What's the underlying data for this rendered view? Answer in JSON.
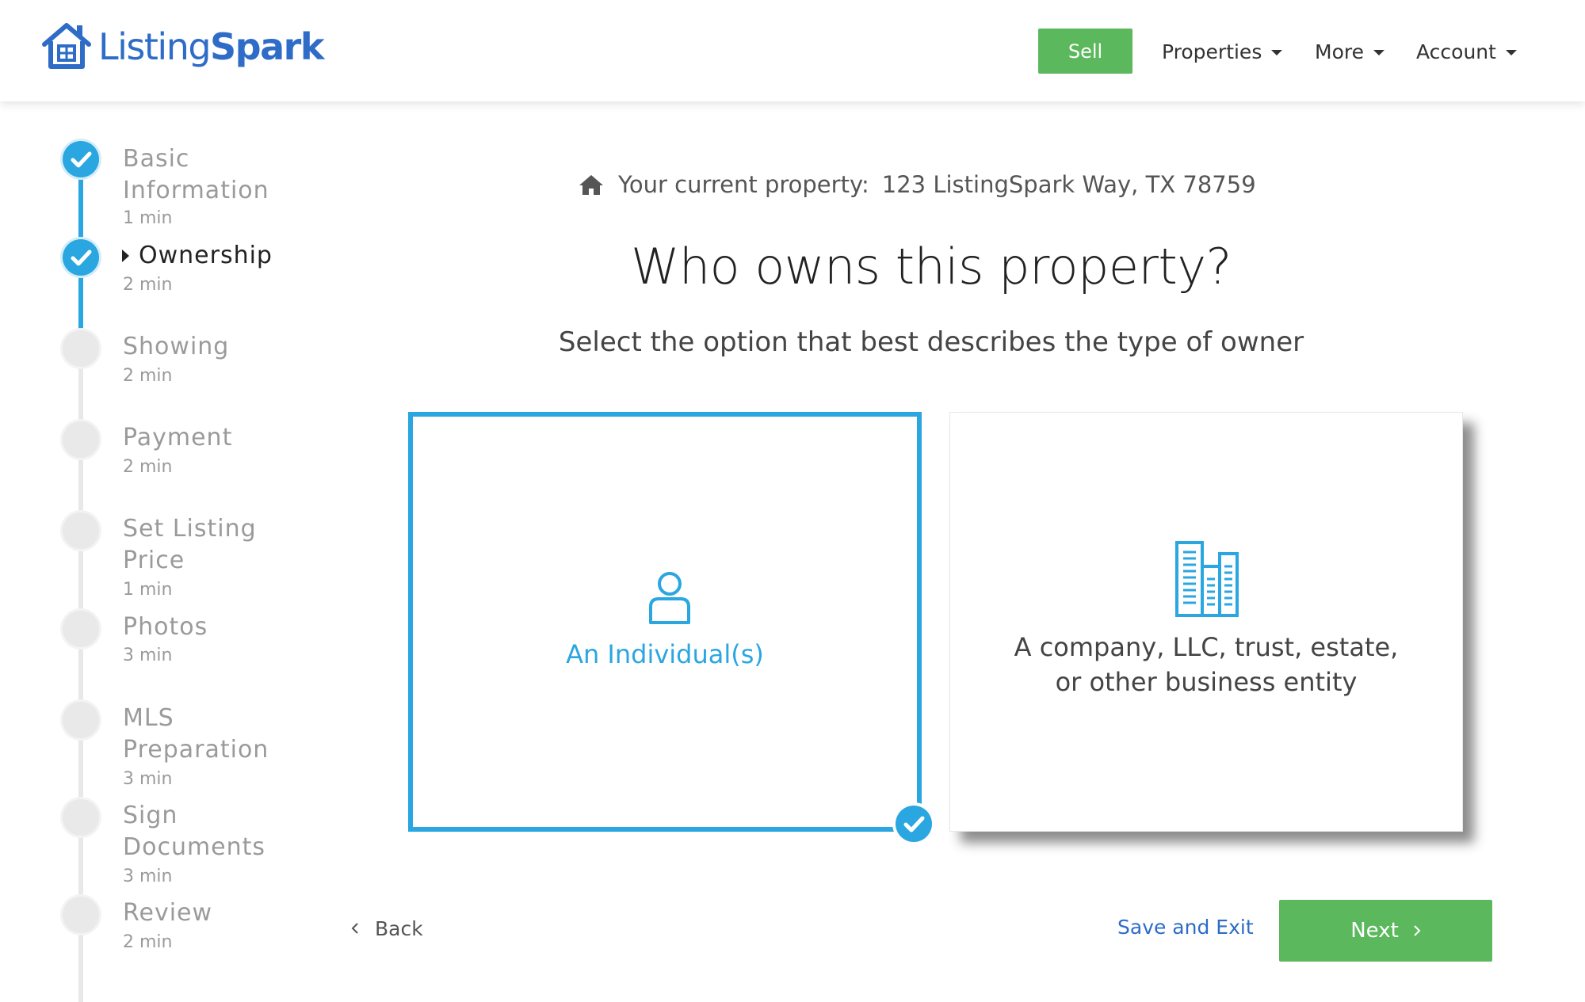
{
  "header": {
    "logo": {
      "part1": "Listing",
      "part2": "Spark"
    },
    "sell_label": "Sell",
    "nav": [
      {
        "label": "Properties"
      },
      {
        "label": "More"
      },
      {
        "label": "Account"
      }
    ]
  },
  "steps": [
    {
      "label": "Basic Information",
      "time": "1 min",
      "status": "done"
    },
    {
      "label": "Ownership",
      "time": "2 min",
      "status": "current"
    },
    {
      "label": "Showing",
      "time": "2 min",
      "status": "todo"
    },
    {
      "label": "Payment",
      "time": "2 min",
      "status": "todo"
    },
    {
      "label": "Set Listing Price",
      "time": "1 min",
      "status": "todo"
    },
    {
      "label": "Photos",
      "time": "3 min",
      "status": "todo"
    },
    {
      "label": "MLS Preparation",
      "time": "3 min",
      "status": "todo"
    },
    {
      "label": "Sign Documents",
      "time": "3 min",
      "status": "todo"
    },
    {
      "label": "Review",
      "time": "2 min",
      "status": "todo"
    }
  ],
  "main": {
    "current_property_label": "Your current property:",
    "current_property_address": "123 ListingSpark Way, TX 78759",
    "question": "Who owns this property?",
    "subquestion": "Select the option that best describes the type of owner",
    "options": [
      {
        "label": "An Individual(s)",
        "icon": "person-icon",
        "selected": true
      },
      {
        "label_line1": "A company, LLC, trust, estate,",
        "label_line2": "or other business entity",
        "icon": "buildings-icon",
        "selected": false
      }
    ],
    "back_label": "Back",
    "save_exit_label": "Save and Exit",
    "next_label": "Next"
  },
  "colors": {
    "brand_blue": "#2e6cc7",
    "accent_blue": "#2aa6e0",
    "green": "#5cb85c"
  }
}
